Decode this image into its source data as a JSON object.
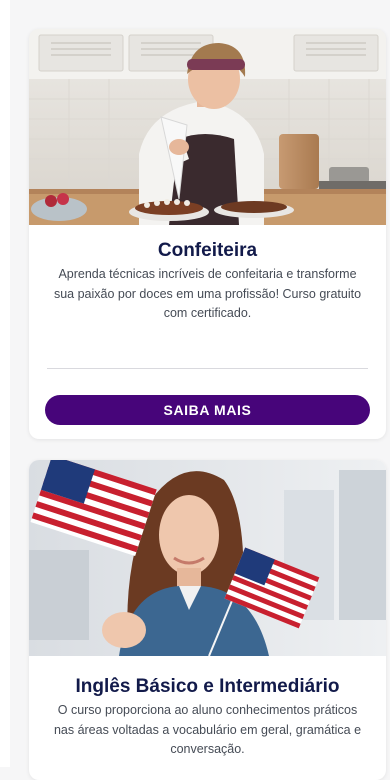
{
  "courses": [
    {
      "title": "Confeiteira",
      "description": "Aprenda técnicas incríveis de confeitaria e transforme sua paixão por doces em uma profissão! Curso gratuito com certificado.",
      "button_label": "SAIBA MAIS",
      "image_subject": "pastry-chef-decorating-cake-photo"
    },
    {
      "title": "Inglês Básico e Intermediário",
      "description": "O curso proporciona ao aluno conhecimentos práticos nas áreas voltadas a vocabulário em geral, gramática e conversação.",
      "image_subject": "woman-holding-us-flags-photo"
    }
  ],
  "colors": {
    "accent": "#47057a",
    "title": "#121a4a",
    "text": "#454b55",
    "background": "#f6f6f7"
  }
}
